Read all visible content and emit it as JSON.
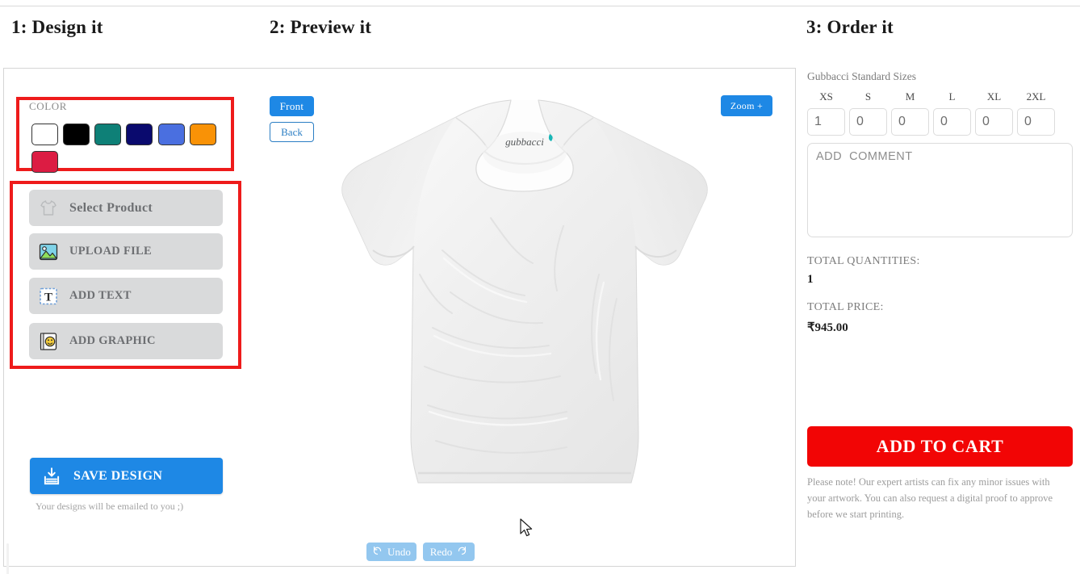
{
  "headers": {
    "step1": "1: Design it",
    "step2": "2: Preview it",
    "step3": "3: Order it"
  },
  "design": {
    "color_label": "COLOR",
    "swatches": [
      {
        "name": "white",
        "hex": "#ffffff"
      },
      {
        "name": "black",
        "hex": "#000000"
      },
      {
        "name": "teal",
        "hex": "#0e8077"
      },
      {
        "name": "navy",
        "hex": "#0a0a6e"
      },
      {
        "name": "royal-blue",
        "hex": "#4a6fe0"
      },
      {
        "name": "orange",
        "hex": "#f99206"
      },
      {
        "name": "crimson",
        "hex": "#dc1c43"
      }
    ],
    "tools": [
      {
        "label": "Select Product",
        "icon": "tshirt-icon"
      },
      {
        "label": "UPLOAD FILE",
        "icon": "image-icon"
      },
      {
        "label": "ADD TEXT",
        "icon": "text-icon"
      },
      {
        "label": "ADD GRAPHIC",
        "icon": "smiley-icon"
      }
    ],
    "save_button": "SAVE DESIGN",
    "save_note": "Your designs will be emailed to you ;)"
  },
  "preview": {
    "front_button": "Front",
    "back_button": "Back",
    "zoom_button": "Zoom +",
    "undo_button": "Undo",
    "redo_button": "Redo",
    "shirt_brand": "gubbacci",
    "shirt_color": "#f2f2f2"
  },
  "order": {
    "sizes_title": "Gubbacci Standard Sizes",
    "sizes": [
      {
        "label": "XS",
        "value": "1"
      },
      {
        "label": "S",
        "value": "0"
      },
      {
        "label": "M",
        "value": "0"
      },
      {
        "label": "L",
        "value": "0"
      },
      {
        "label": "XL",
        "value": "0"
      },
      {
        "label": "2XL",
        "value": "0"
      }
    ],
    "comment_placeholder": "ADD  COMMENT",
    "comment_value": "",
    "total_quantities_label": "TOTAL QUANTITIES:",
    "total_quantities_value": "1",
    "total_price_label": "TOTAL PRICE:",
    "total_price_value": "₹945.00",
    "add_to_cart": "ADD TO CART",
    "note": "Please note! Our expert artists can fix any minor issues with your artwork. You can also request a digital proof to approve before we start printing.",
    "accent_color": "#f20505"
  }
}
